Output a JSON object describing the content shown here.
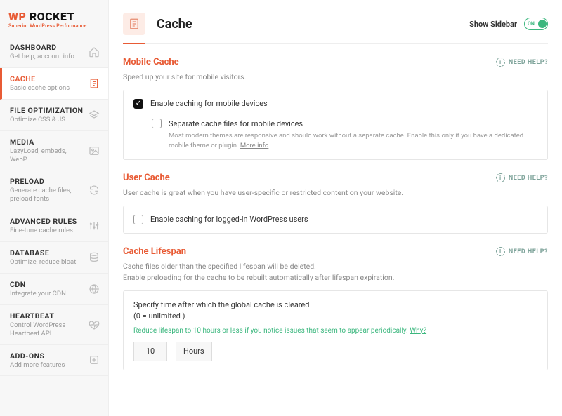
{
  "logo": {
    "wp": "WP",
    "rocket": "ROCKET",
    "tagline": "Superior WordPress Performance"
  },
  "sidebar": {
    "items": [
      {
        "title": "DASHBOARD",
        "sub": "Get help, account info",
        "icon": "home"
      },
      {
        "title": "CACHE",
        "sub": "Basic cache options",
        "icon": "doc",
        "active": true
      },
      {
        "title": "FILE OPTIMIZATION",
        "sub": "Optimize CSS & JS",
        "icon": "layers"
      },
      {
        "title": "MEDIA",
        "sub": "LazyLoad, embeds, WebP",
        "icon": "image"
      },
      {
        "title": "PRELOAD",
        "sub": "Generate cache files, preload fonts",
        "icon": "refresh"
      },
      {
        "title": "ADVANCED RULES",
        "sub": "Fine-tune cache rules",
        "icon": "sliders"
      },
      {
        "title": "DATABASE",
        "sub": "Optimize, reduce bloat",
        "icon": "database"
      },
      {
        "title": "CDN",
        "sub": "Integrate your CDN",
        "icon": "globe"
      },
      {
        "title": "HEARTBEAT",
        "sub": "Control WordPress Heartbeat API",
        "icon": "heart"
      },
      {
        "title": "ADD-ONS",
        "sub": "Add more features",
        "icon": "plus"
      }
    ]
  },
  "page": {
    "title": "Cache",
    "show_sidebar": "Show Sidebar",
    "toggle_on": "ON"
  },
  "need_help": "NEED HELP?",
  "sections": {
    "mobile": {
      "title": "Mobile Cache",
      "desc": "Speed up your site for mobile visitors.",
      "opt1": "Enable caching for mobile devices",
      "opt2": "Separate cache files for mobile devices",
      "opt2_desc": "Most modern themes are responsive and should work without a separate cache. Enable this only if you have a dedicated mobile theme or plugin. ",
      "more": "More info"
    },
    "user": {
      "title": "User Cache",
      "desc_link": "User cache",
      "desc_rest": " is great when you have user-specific or restricted content on your website.",
      "opt1": "Enable caching for logged-in WordPress users"
    },
    "lifespan": {
      "title": "Cache Lifespan",
      "desc1": "Cache files older than the specified lifespan will be deleted.",
      "desc2a": "Enable ",
      "desc2_link": "preloading",
      "desc2b": " for the cache to be rebuilt automatically after lifespan expiration.",
      "label1": "Specify time after which the global cache is cleared",
      "label2": "(0 = unlimited )",
      "tip": "Reduce lifespan to 10 hours or less if you notice issues that seem to appear periodically. ",
      "why": "Why?",
      "value": "10",
      "unit": "Hours"
    }
  }
}
